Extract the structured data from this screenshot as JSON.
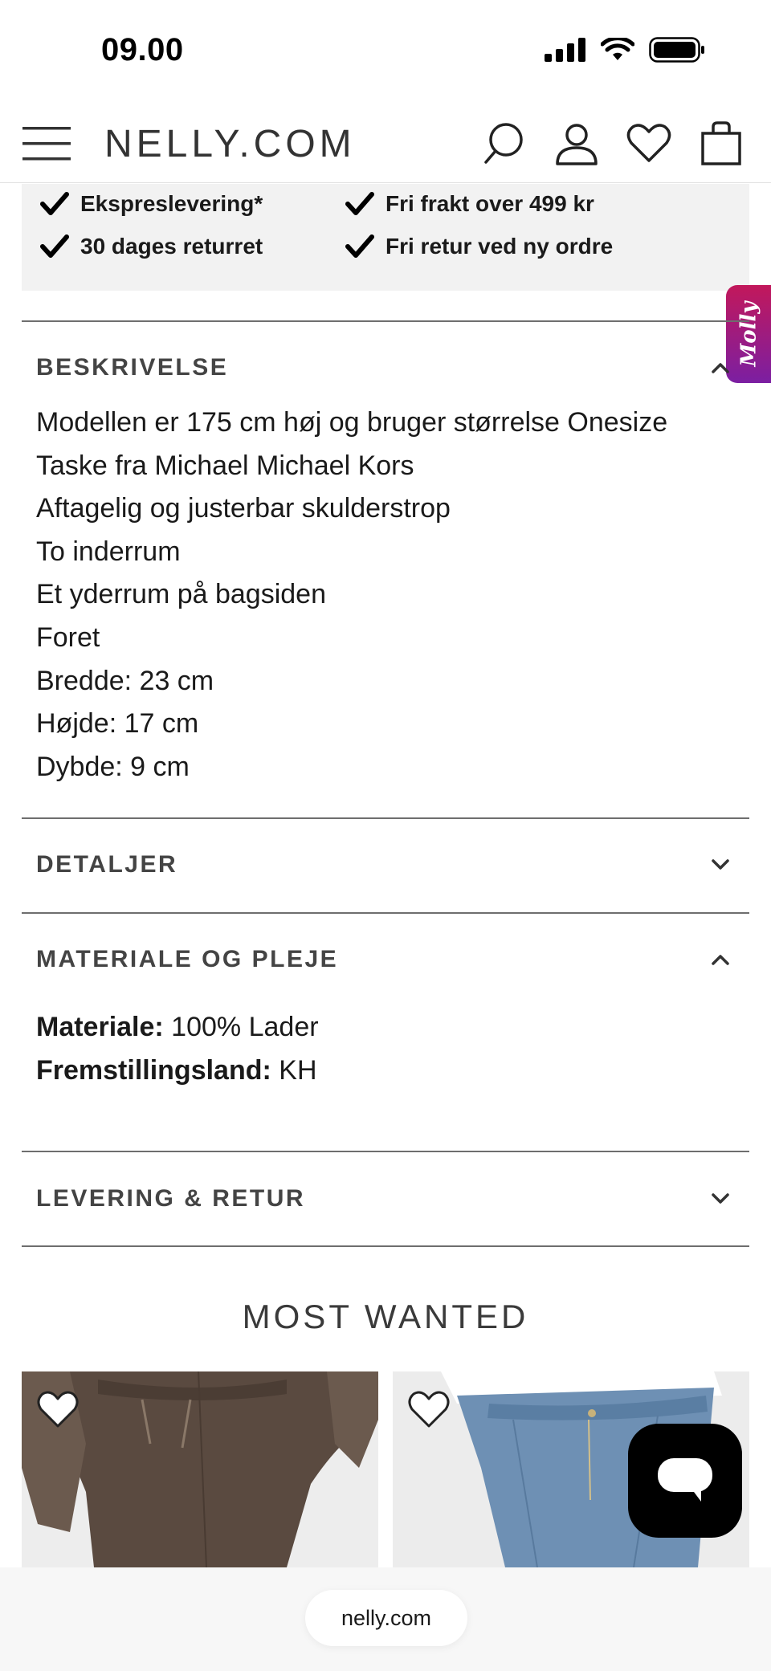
{
  "status_bar": {
    "time": "09.00"
  },
  "header": {
    "logo": "NELLY.COM",
    "icons": [
      "menu-icon",
      "search-icon",
      "account-icon",
      "wishlist-heart-icon",
      "shopping-bag-icon"
    ]
  },
  "usp": [
    {
      "label": "Ekspreslevering*"
    },
    {
      "label": "Fri frakt over 499 kr"
    },
    {
      "label": "30 dages returret"
    },
    {
      "label": "Fri retur ved ny ordre"
    }
  ],
  "molly_tab": {
    "label": "Molly",
    "color_top": "#c2185b",
    "color_bottom": "#7b1fa2"
  },
  "accordion": {
    "description": {
      "title": "BESKRIVELSE",
      "expanded": true,
      "lines": [
        "Modellen er 175 cm høj og bruger størrelse Onesize",
        "Taske fra Michael Michael Kors",
        "Aftagelig og justerbar skulderstrop",
        "To inderrum",
        "Et yderrum på bagsiden",
        "Foret",
        "Bredde: 23 cm",
        "Højde: 17 cm",
        "Dybde: 9 cm"
      ]
    },
    "details": {
      "title": "DETALJER",
      "expanded": false
    },
    "material": {
      "title": "MATERIALE OG PLEJE",
      "expanded": true,
      "material_label": "Materiale:",
      "material_value": " 100% Lader",
      "country_label": "Fremstillingsland:",
      "country_value": " KH"
    },
    "delivery": {
      "title": "LEVERING & RETUR",
      "expanded": false
    }
  },
  "most_wanted": {
    "title": "MOST WANTED",
    "products": [
      {
        "image": "brown-knit-trousers",
        "wishlist_icon": "heart-icon"
      },
      {
        "image": "blue-denim-jeans",
        "wishlist_icon": "heart-icon"
      }
    ]
  },
  "chat": {
    "icon": "chat-bubble-icon"
  },
  "browser": {
    "url": "nelly.com"
  },
  "colors": {
    "divider": "#6e6e6e",
    "usp_bg": "#f2f2f2",
    "chat_bg": "#000000"
  }
}
